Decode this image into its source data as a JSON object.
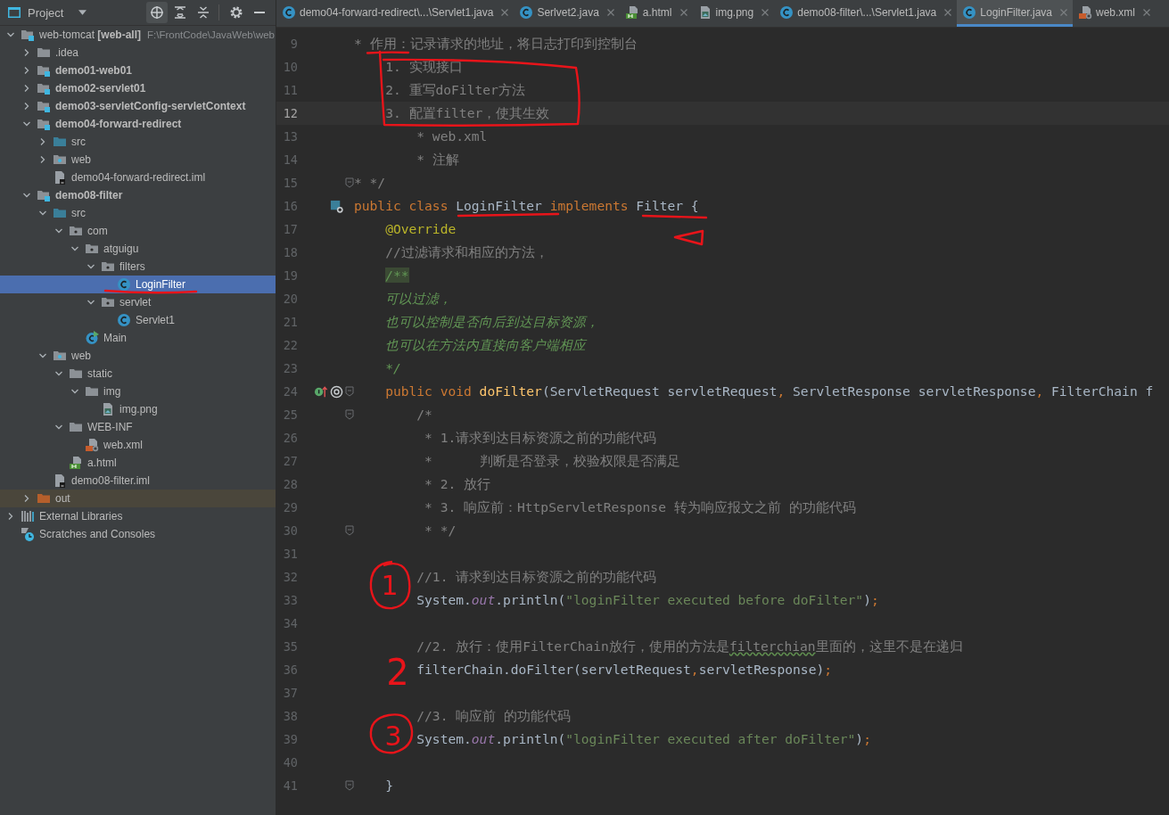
{
  "sidebar": {
    "title": "Project",
    "tree": [
      {
        "label": "web-tomcat **[web-all]**",
        "path": "F:\\FrontCode\\JavaWeb\\web",
        "kind": "project",
        "expanded": true,
        "selected": false,
        "children": [
          {
            "label": ".idea",
            "kind": "folder",
            "expanded": false,
            "selected": false
          },
          {
            "label": "demo01-web01",
            "kind": "module",
            "expanded": false,
            "selected": false
          },
          {
            "label": "demo02-servlet01",
            "kind": "module",
            "expanded": false,
            "selected": false
          },
          {
            "label": "demo03-servletConfig-servletContext",
            "kind": "module",
            "expanded": false,
            "selected": false
          },
          {
            "label": "demo04-forward-redirect",
            "kind": "module",
            "expanded": true,
            "selected": false,
            "children": [
              {
                "label": "src",
                "kind": "src",
                "expanded": false,
                "selected": false
              },
              {
                "label": "web",
                "kind": "webroot",
                "expanded": false,
                "selected": false
              },
              {
                "label": "demo04-forward-redirect.iml",
                "kind": "iml",
                "selected": false
              }
            ]
          },
          {
            "label": "demo08-filter",
            "kind": "module",
            "expanded": true,
            "selected": false,
            "children": [
              {
                "label": "src",
                "kind": "src",
                "expanded": true,
                "selected": false,
                "children": [
                  {
                    "label": "com",
                    "kind": "package",
                    "expanded": true,
                    "selected": false,
                    "children": [
                      {
                        "label": "atguigu",
                        "kind": "package",
                        "expanded": true,
                        "selected": false,
                        "children": [
                          {
                            "label": "filters",
                            "kind": "package",
                            "expanded": true,
                            "selected": false,
                            "children": [
                              {
                                "label": "LoginFilter",
                                "kind": "class",
                                "selected": true
                              }
                            ]
                          },
                          {
                            "label": "servlet",
                            "kind": "package",
                            "expanded": true,
                            "selected": false,
                            "children": [
                              {
                                "label": "Servlet1",
                                "kind": "class",
                                "selected": false
                              }
                            ]
                          }
                        ]
                      },
                      {
                        "label": "Main",
                        "kind": "main",
                        "selected": false
                      }
                    ]
                  }
                ]
              },
              {
                "label": "web",
                "kind": "webroot",
                "expanded": true,
                "selected": false,
                "children": [
                  {
                    "label": "static",
                    "kind": "folder",
                    "expanded": true,
                    "selected": false,
                    "children": [
                      {
                        "label": "img",
                        "kind": "folder",
                        "expanded": true,
                        "selected": false,
                        "children": [
                          {
                            "label": "img.png",
                            "kind": "image",
                            "selected": false
                          }
                        ]
                      }
                    ]
                  },
                  {
                    "label": "WEB-INF",
                    "kind": "folder",
                    "expanded": true,
                    "selected": false,
                    "children": [
                      {
                        "label": "web.xml",
                        "kind": "xml",
                        "selected": false
                      }
                    ]
                  },
                  {
                    "label": "a.html",
                    "kind": "html",
                    "selected": false
                  }
                ]
              },
              {
                "label": "demo08-filter.iml",
                "kind": "iml",
                "selected": false
              }
            ]
          },
          {
            "label": "out",
            "kind": "excluded",
            "expanded": false,
            "selected": false
          }
        ]
      },
      {
        "label": "External Libraries",
        "kind": "libraries",
        "expanded": false,
        "selected": false
      },
      {
        "label": "Scratches and Consoles",
        "kind": "scratches",
        "selected": false
      }
    ]
  },
  "tabs": [
    {
      "label": "demo04-forward-redirect\\...\\Servlet1.java",
      "kind": "class",
      "selected": false
    },
    {
      "label": "Serlvet2.java",
      "kind": "class",
      "selected": false
    },
    {
      "label": "a.html",
      "kind": "html",
      "selected": false
    },
    {
      "label": "img.png",
      "kind": "image",
      "selected": false
    },
    {
      "label": "demo08-filter\\...\\Servlet1.java",
      "kind": "class",
      "selected": false
    },
    {
      "label": "LoginFilter.java",
      "kind": "class",
      "selected": true
    },
    {
      "label": "web.xml",
      "kind": "xml",
      "selected": false
    }
  ],
  "editor": {
    "lines": [
      {
        "number": "9",
        "current": false,
        "fold": false,
        "tokens": [
          {
            "kind": "cmt",
            "text": "* 作用：记录请求的地址，将日志打印到控制台"
          }
        ]
      },
      {
        "number": "10",
        "current": false,
        "fold": false,
        "tokens": [
          {
            "kind": "cmt",
            "text": "    1. 实现接口"
          }
        ]
      },
      {
        "number": "11",
        "current": false,
        "fold": false,
        "tokens": [
          {
            "kind": "cmt",
            "text": "    2. 重写doFilter方法"
          }
        ]
      },
      {
        "number": "12",
        "current": true,
        "fold": false,
        "tokens": [
          {
            "kind": "cmt",
            "text": "    3. 配置filter，使其生效"
          }
        ]
      },
      {
        "number": "13",
        "current": false,
        "fold": false,
        "tokens": [
          {
            "kind": "cmt",
            "text": "        * web.xml"
          }
        ]
      },
      {
        "number": "14",
        "current": false,
        "fold": false,
        "tokens": [
          {
            "kind": "cmt",
            "text": "        * 注解"
          }
        ]
      },
      {
        "number": "15",
        "current": false,
        "fold": true,
        "tokens": [
          {
            "kind": "cmt",
            "text": "* */"
          }
        ]
      },
      {
        "number": "16",
        "current": false,
        "fold": false,
        "gutter": {
          "kind": "class"
        },
        "tokens": [
          {
            "kind": "kw",
            "text": "public class "
          },
          {
            "kind": "plain",
            "text": "LoginFilter"
          },
          {
            "kind": "kw",
            "text": " implements "
          },
          {
            "kind": "plain",
            "text": "Filter {"
          }
        ]
      },
      {
        "number": "17",
        "current": false,
        "fold": false,
        "tokens": [
          {
            "kind": "ann",
            "text": "    @Override"
          }
        ]
      },
      {
        "number": "18",
        "current": false,
        "fold": false,
        "tokens": [
          {
            "kind": "cmt",
            "text": "    //过滤请求和相应的方法，"
          }
        ]
      },
      {
        "number": "19",
        "current": false,
        "fold": false,
        "tokens": [
          {
            "kind": "dochl",
            "text": "    /**"
          }
        ]
      },
      {
        "number": "20",
        "current": false,
        "fold": false,
        "tokens": [
          {
            "kind": "doc",
            "text": "    可以过滤，"
          }
        ]
      },
      {
        "number": "21",
        "current": false,
        "fold": false,
        "tokens": [
          {
            "kind": "doc",
            "text": "    也可以控制是否向后到达目标资源，"
          }
        ]
      },
      {
        "number": "22",
        "current": false,
        "fold": false,
        "tokens": [
          {
            "kind": "doc",
            "text": "    也可以在方法内直接向客户端相应"
          }
        ]
      },
      {
        "number": "23",
        "current": false,
        "fold": false,
        "tokens": [
          {
            "kind": "doc",
            "text": "    */"
          }
        ]
      },
      {
        "number": "24",
        "current": false,
        "fold": true,
        "gutter": {
          "kind": "override"
        },
        "tokens": [
          {
            "kind": "kw",
            "text": "    public void "
          },
          {
            "kind": "fn",
            "text": "doFilter"
          },
          {
            "kind": "plain",
            "text": "(ServletRequest servletRequest"
          },
          {
            "kind": "kw",
            "text": ", "
          },
          {
            "kind": "plain",
            "text": "ServletResponse servletResponse"
          },
          {
            "kind": "kw",
            "text": ", "
          },
          {
            "kind": "plain",
            "text": "FilterChain f"
          }
        ]
      },
      {
        "number": "25",
        "current": false,
        "fold": true,
        "tokens": [
          {
            "kind": "cmt",
            "text": "        /*"
          }
        ]
      },
      {
        "number": "26",
        "current": false,
        "fold": false,
        "tokens": [
          {
            "kind": "cmt",
            "text": "         * 1.请求到达目标资源之前的功能代码"
          }
        ]
      },
      {
        "number": "27",
        "current": false,
        "fold": false,
        "tokens": [
          {
            "kind": "cmt",
            "text": "         *      判断是否登录，校验权限是否满足"
          }
        ]
      },
      {
        "number": "28",
        "current": false,
        "fold": false,
        "tokens": [
          {
            "kind": "cmt",
            "text": "         * 2. 放行"
          }
        ]
      },
      {
        "number": "29",
        "current": false,
        "fold": false,
        "tokens": [
          {
            "kind": "cmt",
            "text": "         * 3. 响应前：HttpServletResponse 转为响应报文之前 的功能代码"
          }
        ]
      },
      {
        "number": "30",
        "current": false,
        "fold": true,
        "tokens": [
          {
            "kind": "cmt",
            "text": "         * */"
          }
        ]
      },
      {
        "number": "31",
        "current": false,
        "fold": false
      },
      {
        "number": "32",
        "current": false,
        "fold": false,
        "tokens": [
          {
            "kind": "cmt",
            "text": "        //1. 请求到达目标资源之前的功能代码"
          }
        ]
      },
      {
        "number": "33",
        "current": false,
        "fold": false,
        "tokens": [
          {
            "kind": "plain",
            "text": "        System."
          },
          {
            "kind": "field",
            "text": "out"
          },
          {
            "kind": "plain",
            "text": ".println("
          },
          {
            "kind": "str",
            "text": "\"loginFilter executed before doFilter\""
          },
          {
            "kind": "plain",
            "text": ")"
          },
          {
            "kind": "kw",
            "text": ";"
          }
        ]
      },
      {
        "number": "34",
        "current": false,
        "fold": false
      },
      {
        "number": "35",
        "current": false,
        "fold": false,
        "tokens": [
          {
            "kind": "cmt",
            "text": "        //2. 放行：使用FilterChain放行，使用的方法是"
          },
          {
            "kind": "typo",
            "text": "filterchian"
          },
          {
            "kind": "cmt",
            "text": "里面的，这里不是在递归"
          }
        ]
      },
      {
        "number": "36",
        "current": false,
        "fold": false,
        "tokens": [
          {
            "kind": "plain",
            "text": "        filterChain.doFilter(servletRequest"
          },
          {
            "kind": "kw",
            "text": ","
          },
          {
            "kind": "plain",
            "text": "servletResponse)"
          },
          {
            "kind": "kw",
            "text": ";"
          }
        ]
      },
      {
        "number": "37",
        "current": false,
        "fold": false
      },
      {
        "number": "38",
        "current": false,
        "fold": false,
        "tokens": [
          {
            "kind": "cmt",
            "text": "        //3. 响应前 的功能代码"
          }
        ]
      },
      {
        "number": "39",
        "current": false,
        "fold": false,
        "tokens": [
          {
            "kind": "plain",
            "text": "        System."
          },
          {
            "kind": "field",
            "text": "out"
          },
          {
            "kind": "plain",
            "text": ".println("
          },
          {
            "kind": "str",
            "text": "\"loginFilter executed after doFilter\""
          },
          {
            "kind": "plain",
            "text": ")"
          },
          {
            "kind": "kw",
            "text": ";"
          }
        ]
      },
      {
        "number": "40",
        "current": false,
        "fold": false
      },
      {
        "number": "41",
        "current": false,
        "fold": true,
        "tokens": [
          {
            "kind": "plain",
            "text": "    }"
          }
        ]
      }
    ]
  },
  "annotations": [
    {
      "kind": "underline"
    },
    {
      "kind": "box"
    },
    {
      "kind": "underline"
    },
    {
      "kind": "underline"
    },
    {
      "kind": "triangle"
    },
    {
      "kind": "underline"
    },
    {
      "kind": "circled-number",
      "label": "1"
    },
    {
      "kind": "handwritten-number",
      "label": "2"
    },
    {
      "kind": "circled-number",
      "label": "3"
    }
  ]
}
